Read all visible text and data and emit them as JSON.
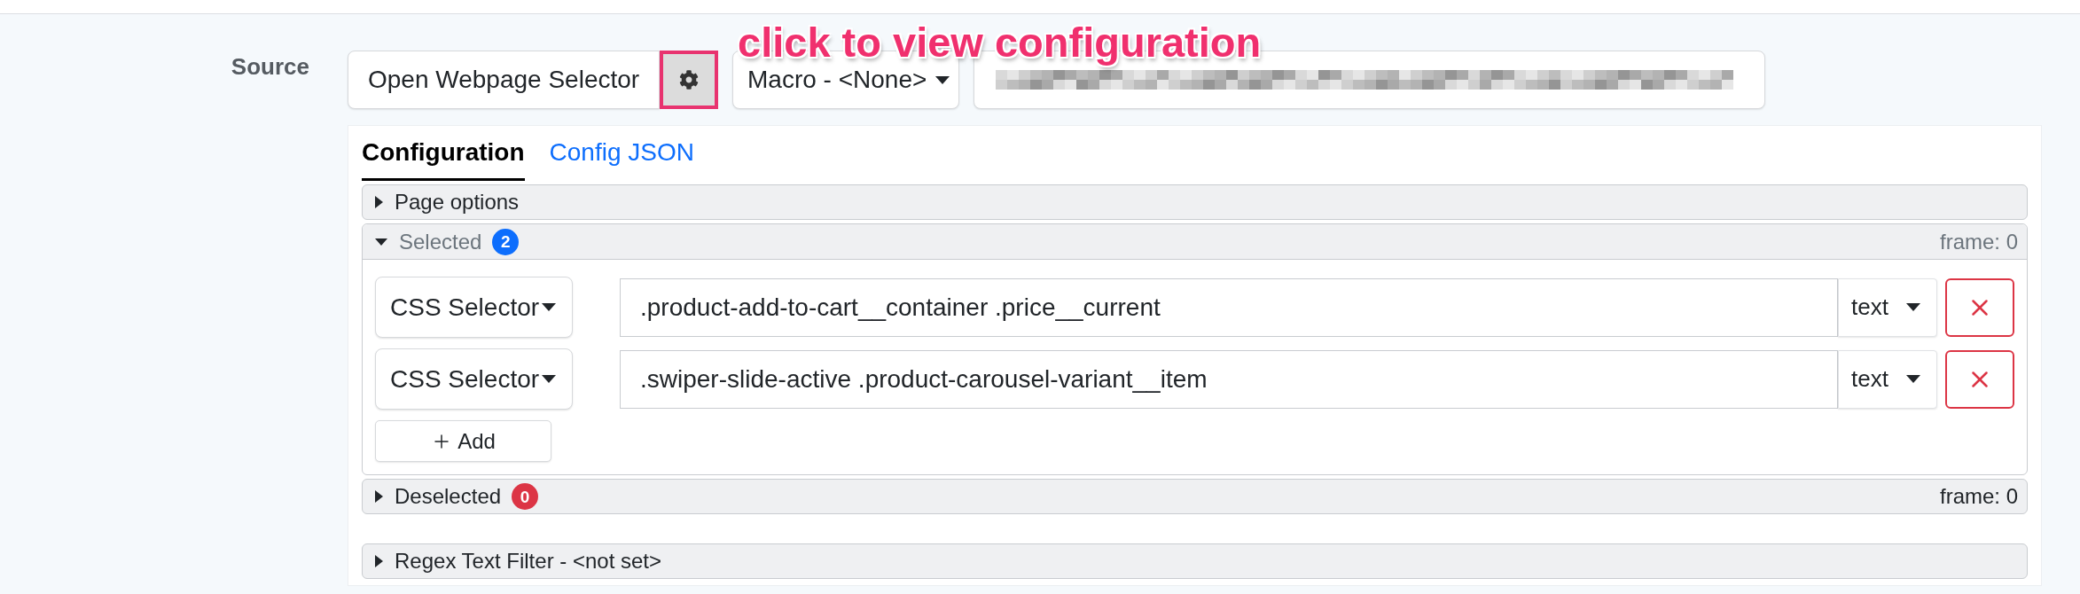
{
  "annotation": {
    "text": "click to view configuration"
  },
  "source": {
    "label": "Source",
    "selector_button": "Open Webpage Selector",
    "settings_button": {
      "highlighted": true
    },
    "macro_dropdown": "Macro - <None>"
  },
  "tabs": [
    {
      "label": "Configuration",
      "selected": true
    },
    {
      "label": "Config JSON",
      "selected": false
    }
  ],
  "accordion": [
    {
      "title": "Page options",
      "expanded": false
    },
    {
      "title": "Selected",
      "expanded": true,
      "badge": {
        "text": "2",
        "color": "#0d6efd"
      },
      "frame": "frame: 0",
      "rows": [
        {
          "method": "CSS Selector",
          "selector": ".product-add-to-cart__container .price__current",
          "output": "text"
        },
        {
          "method": "CSS Selector",
          "selector": ".swiper-slide-active .product-carousel-variant__item",
          "output": "text"
        }
      ],
      "add_button": "Add"
    },
    {
      "title": "Deselected",
      "expanded": false,
      "badge": {
        "text": "0",
        "color": "#dc3545"
      },
      "frame": "frame: 0"
    }
  ],
  "filters": [
    {
      "title": "Regex Text Filter - <not set>",
      "expanded": false
    }
  ]
}
